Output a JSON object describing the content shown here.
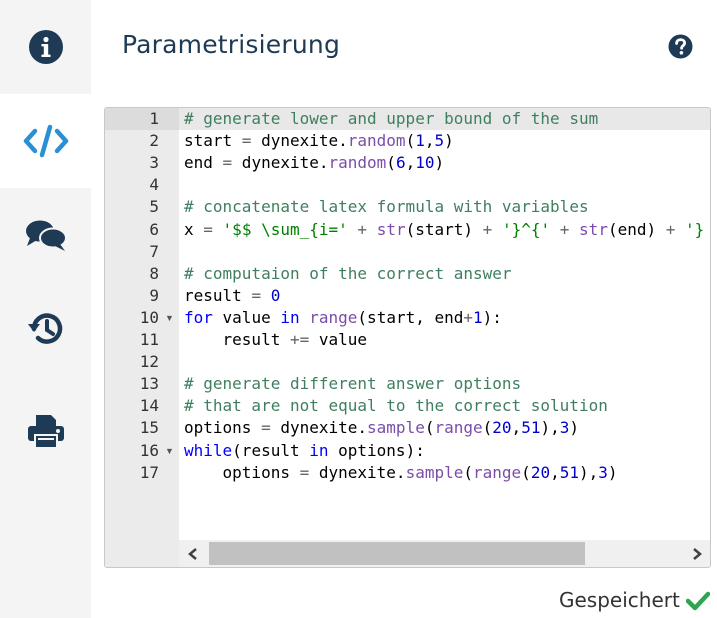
{
  "sidebar": {
    "items": [
      {
        "icon": "info-icon",
        "active": false
      },
      {
        "icon": "code-icon",
        "active": true
      },
      {
        "icon": "comments-icon",
        "active": false
      },
      {
        "icon": "history-icon",
        "active": false
      },
      {
        "icon": "print-icon",
        "active": false
      }
    ],
    "icon_color": "#1e3a55",
    "active_color": "#2b8fd6"
  },
  "header": {
    "title": "Parametrisierung",
    "help_icon": "question-circle-icon"
  },
  "editor": {
    "line_numbers": [
      "1",
      "2",
      "3",
      "4",
      "5",
      "6",
      "7",
      "8",
      "9",
      "10",
      "11",
      "12",
      "13",
      "14",
      "15",
      "16",
      "17"
    ],
    "lines": [
      "# generate lower and upper bound of the sum",
      "start = dynexite.random(1,5)",
      "end = dynexite.random(6,10)",
      "",
      "# concatenate latex formula with variables",
      "x = '$$ \\sum_{i=' + str(start) + '}^{' + str(end) + '}",
      "",
      "# computaion of the correct answer",
      "result = 0",
      "for value in range(start, end+1):",
      "    result += value",
      "",
      "# generate different answer options",
      "# that are not equal to the correct solution",
      "options = dynexite.sample(range(20,51),3)",
      "while(result in options):",
      "    options = dynexite.sample(range(20,51),3)"
    ],
    "fold_lines": [
      10,
      16
    ],
    "active_line": 1
  },
  "status": {
    "text": "Gespeichert",
    "icon": "check-icon",
    "icon_color": "#2ea44f"
  }
}
